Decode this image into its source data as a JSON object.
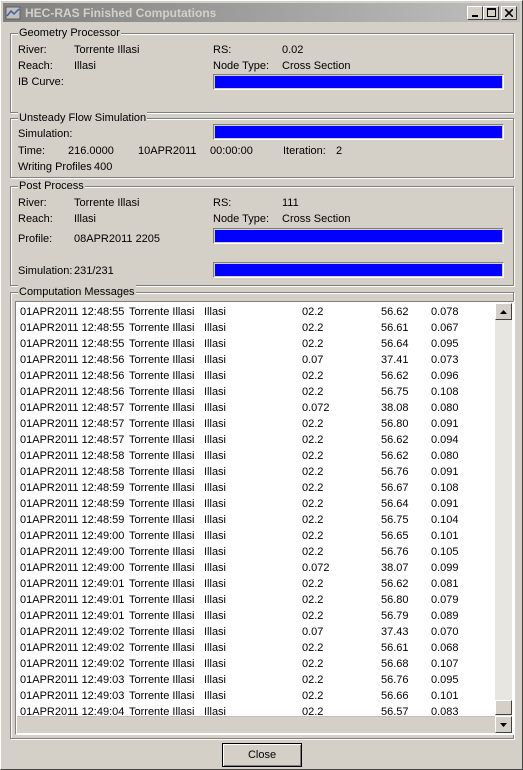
{
  "window": {
    "title": "HEC-RAS Finished Computations"
  },
  "geometry": {
    "group_label": "Geometry Processor",
    "river_label": "River:",
    "river_value": "Torrente Illasi",
    "reach_label": "Reach:",
    "reach_value": "Illasi",
    "rs_label": "RS:",
    "rs_value": "0.02",
    "node_label": "Node Type:",
    "node_value": "Cross Section",
    "ib_label": "IB Curve:",
    "progress": 1.0
  },
  "unsteady": {
    "group_label": "Unsteady Flow Simulation",
    "sim_label": "Simulation:",
    "time_label": "Time:",
    "time_value": "216.0000",
    "date_value": "10APR2011",
    "clock_value": "00:00:00",
    "iter_label": "Iteration:",
    "iter_value": "2",
    "writing_label": "Writing Profiles",
    "writing_value": "400",
    "progress": 1.0
  },
  "post": {
    "group_label": "Post Process",
    "river_label": "River:",
    "river_value": "Torrente Illasi",
    "reach_label": "Reach:",
    "reach_value": "Illasi",
    "rs_label": "RS:",
    "rs_value": "111",
    "node_label": "Node Type:",
    "node_value": "Cross Section",
    "profile_label": "Profile:",
    "profile_value": "08APR2011 2205",
    "sim_label": "Simulation:",
    "sim_value": "231/231",
    "profile_progress": 1.0,
    "sim_progress": 1.0
  },
  "messages": {
    "group_label": "Computation Messages",
    "rows": [
      [
        "01APR2011 12:48:55",
        "Torrente Illasi",
        "Illasi",
        "02.2",
        "56.62",
        "0.078"
      ],
      [
        "01APR2011 12:48:55",
        "Torrente Illasi",
        "Illasi",
        "02.2",
        "56.61",
        "0.067"
      ],
      [
        "01APR2011 12:48:55",
        "Torrente Illasi",
        "Illasi",
        "02.2",
        "56.64",
        "0.095"
      ],
      [
        "01APR2011 12:48:56",
        "Torrente Illasi",
        "Illasi",
        "0.07",
        "37.41",
        "0.073"
      ],
      [
        "01APR2011 12:48:56",
        "Torrente Illasi",
        "Illasi",
        "02.2",
        "56.62",
        "0.096"
      ],
      [
        "01APR2011 12:48:56",
        "Torrente Illasi",
        "Illasi",
        "02.2",
        "56.75",
        "0.108"
      ],
      [
        "01APR2011 12:48:57",
        "Torrente Illasi",
        "Illasi",
        "0.072",
        "38.08",
        "0.080"
      ],
      [
        "01APR2011 12:48:57",
        "Torrente Illasi",
        "Illasi",
        "02.2",
        "56.80",
        "0.091"
      ],
      [
        "01APR2011 12:48:57",
        "Torrente Illasi",
        "Illasi",
        "02.2",
        "56.62",
        "0.094"
      ],
      [
        "01APR2011 12:48:58",
        "Torrente Illasi",
        "Illasi",
        "02.2",
        "56.62",
        "0.080"
      ],
      [
        "01APR2011 12:48:58",
        "Torrente Illasi",
        "Illasi",
        "02.2",
        "56.76",
        "0.091"
      ],
      [
        "01APR2011 12:48:59",
        "Torrente Illasi",
        "Illasi",
        "02.2",
        "56.67",
        "0.108"
      ],
      [
        "01APR2011 12:48:59",
        "Torrente Illasi",
        "Illasi",
        "02.2",
        "56.64",
        "0.091"
      ],
      [
        "01APR2011 12:48:59",
        "Torrente Illasi",
        "Illasi",
        "02.2",
        "56.75",
        "0.104"
      ],
      [
        "01APR2011 12:49:00",
        "Torrente Illasi",
        "Illasi",
        "02.2",
        "56.65",
        "0.101"
      ],
      [
        "01APR2011 12:49:00",
        "Torrente Illasi",
        "Illasi",
        "02.2",
        "56.76",
        "0.105"
      ],
      [
        "01APR2011 12:49:00",
        "Torrente Illasi",
        "Illasi",
        "0.072",
        "38.07",
        "0.099"
      ],
      [
        "01APR2011 12:49:01",
        "Torrente Illasi",
        "Illasi",
        "02.2",
        "56.62",
        "0.081"
      ],
      [
        "01APR2011 12:49:01",
        "Torrente Illasi",
        "Illasi",
        "02.2",
        "56.80",
        "0.079"
      ],
      [
        "01APR2011 12:49:01",
        "Torrente Illasi",
        "Illasi",
        "02.2",
        "56.79",
        "0.089"
      ],
      [
        "01APR2011 12:49:02",
        "Torrente Illasi",
        "Illasi",
        "0.07",
        "37.43",
        "0.070"
      ],
      [
        "01APR2011 12:49:02",
        "Torrente Illasi",
        "Illasi",
        "02.2",
        "56.61",
        "0.068"
      ],
      [
        "01APR2011 12:49:02",
        "Torrente Illasi",
        "Illasi",
        "02.2",
        "56.68",
        "0.107"
      ],
      [
        "01APR2011 12:49:03",
        "Torrente Illasi",
        "Illasi",
        "02.2",
        "56.76",
        "0.095"
      ],
      [
        "01APR2011 12:49:03",
        "Torrente Illasi",
        "Illasi",
        "02.2",
        "56.66",
        "0.101"
      ],
      [
        "01APR2011 12:49:04",
        "Torrente Illasi",
        "Illasi",
        "02.2",
        "56.57",
        "0.083"
      ]
    ]
  },
  "close_label": "Close"
}
